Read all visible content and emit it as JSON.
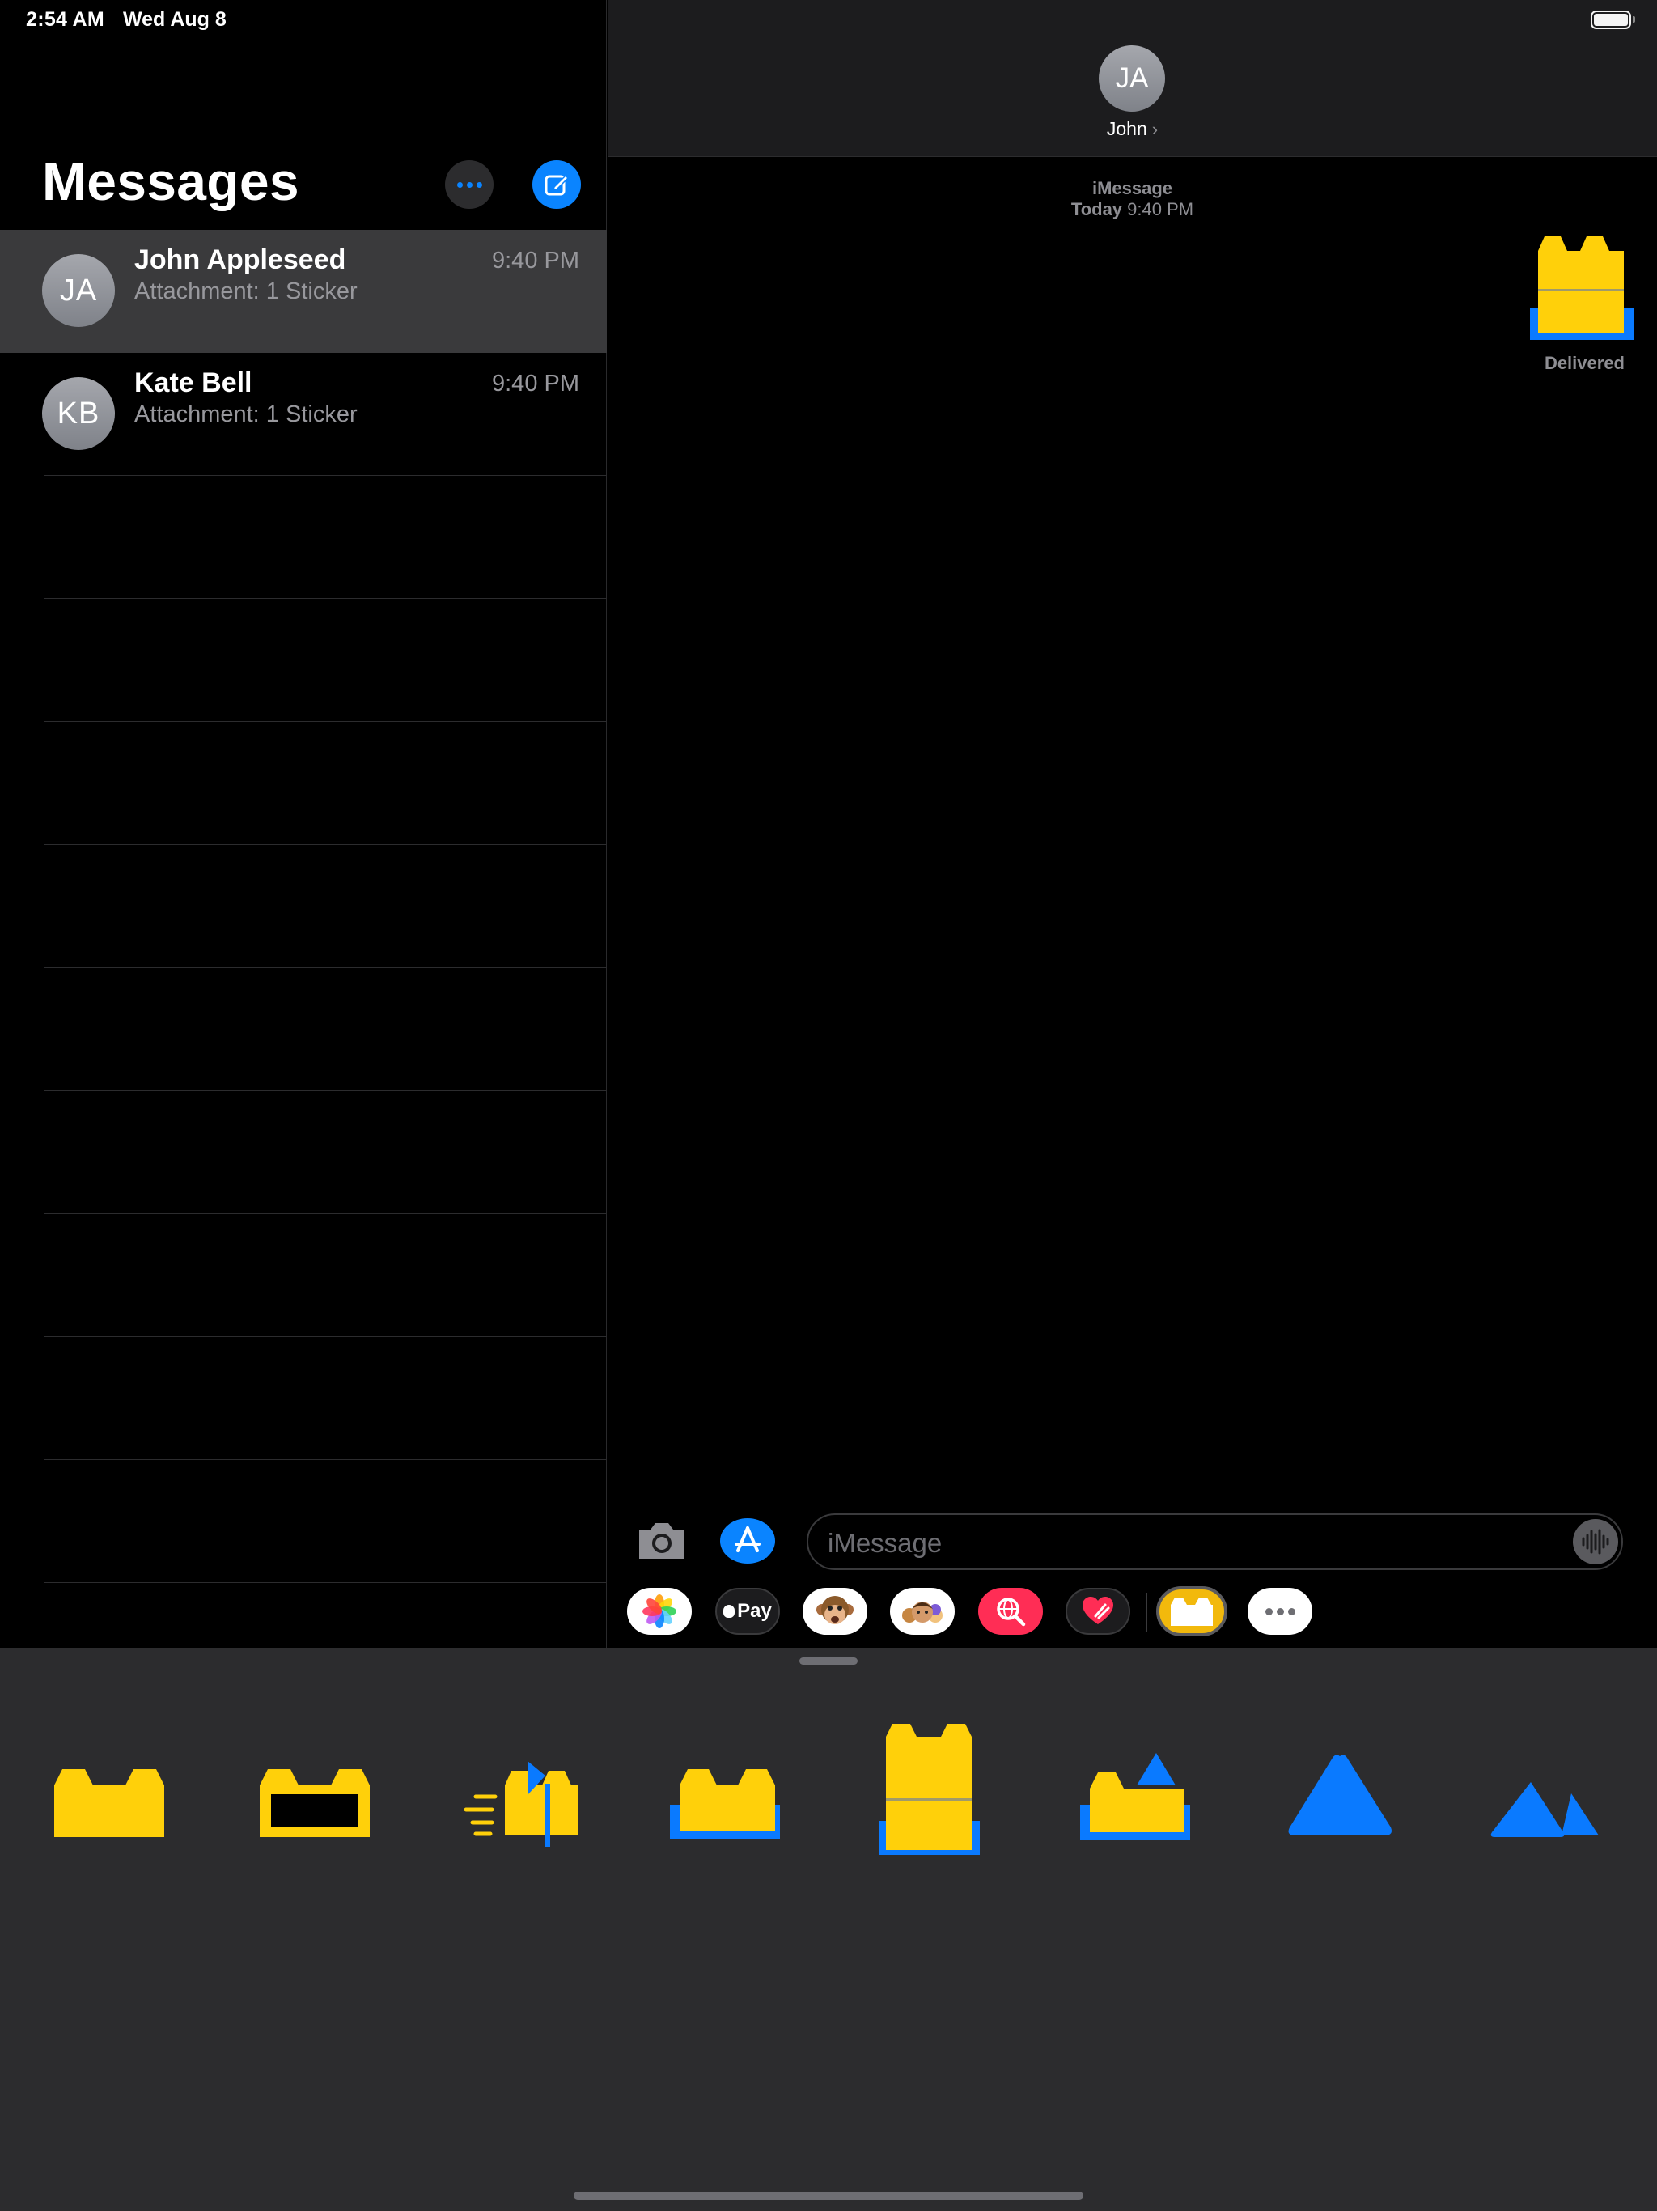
{
  "status_bar": {
    "time": "2:54 AM",
    "date": "Wed Aug 8",
    "battery_level": 1.0
  },
  "sidebar": {
    "title": "Messages",
    "more_icon": "ellipsis-icon",
    "compose_icon": "compose-icon",
    "conversations": [
      {
        "initials": "JA",
        "name": "John Appleseed",
        "time": "9:40 PM",
        "preview": "Attachment: 1 Sticker",
        "selected": true
      },
      {
        "initials": "KB",
        "name": "Kate Bell",
        "time": "9:40 PM",
        "preview": "Attachment: 1 Sticker",
        "selected": false
      }
    ]
  },
  "conversation": {
    "contact_initials": "JA",
    "contact_name": "John",
    "chevron": "›",
    "service": "iMessage",
    "date_label": "Today",
    "time": "9:40 PM",
    "status": "Delivered"
  },
  "compose": {
    "placeholder": "iMessage",
    "camera_icon": "camera-icon",
    "appstore_icon": "app-store-icon",
    "mic_icon": "audio-waveform-icon"
  },
  "app_strip": {
    "apps": [
      "Photos",
      "Apple Pay",
      "Animoji",
      "Memoji",
      "Images Search",
      "Digital Touch",
      "Stickers",
      "More"
    ],
    "pay_label": "Pay"
  },
  "colors": {
    "accent": "#0a84ff",
    "sticker_yellow": "#ffd00a",
    "sticker_blue": "#0a7aff",
    "selected_row": "#3a3a3c",
    "drawer_bg": "#2c2c2e"
  },
  "stickers": [
    "brick",
    "brick-outline",
    "brick-with-flag",
    "brick-on-base",
    "tall-brick-on-base",
    "brick-with-triangle",
    "triangle",
    "double-triangle"
  ]
}
